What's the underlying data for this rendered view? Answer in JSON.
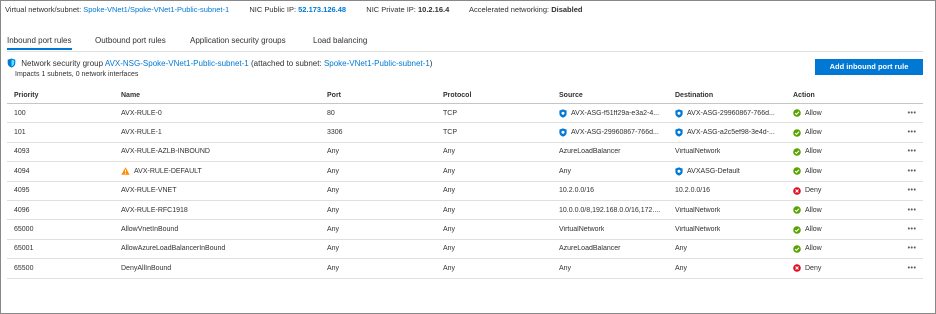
{
  "top_info": {
    "vnet_label": "Virtual network/subnet:",
    "vnet_value": "Spoke-VNet1/Spoke-VNet1-Public-subnet-1",
    "public_ip_label": "NIC Public IP:",
    "public_ip_value": "52.173.126.48",
    "private_ip_label": "NIC Private IP:",
    "private_ip_value": "10.2.16.4",
    "accel_label": "Accelerated networking:",
    "accel_value": "Disabled"
  },
  "tabs": [
    "Inbound port rules",
    "Outbound port rules",
    "Application security groups",
    "Load balancing"
  ],
  "nsg": {
    "prefix": "Network security group",
    "name": "AVX-NSG-Spoke-VNet1-Public-subnet-1",
    "attached_text": "(attached to subnet:",
    "subnet": "Spoke-VNet1-Public-subnet-1",
    "close": ")",
    "impacts": "Impacts 1 subnets, 0 network interfaces"
  },
  "add_button": "Add inbound port rule",
  "columns": {
    "priority": "Priority",
    "name": "Name",
    "port": "Port",
    "protocol": "Protocol",
    "source": "Source",
    "destination": "Destination",
    "action": "Action"
  },
  "rows": [
    {
      "priority": "100",
      "name": "AVX-RULE-0",
      "warn": false,
      "port": "80",
      "protocol": "TCP",
      "source": "AVX-ASG-f51ff29a-e3a2-4...",
      "source_asg": true,
      "destination": "AVX-ASG-29960867-766d...",
      "destination_asg": true,
      "action": "Allow",
      "allow": true
    },
    {
      "priority": "101",
      "name": "AVX-RULE-1",
      "warn": false,
      "port": "3306",
      "protocol": "TCP",
      "source": "AVX-ASG-29960867-766d...",
      "source_asg": true,
      "destination": "AVX-ASG-a2c5ef98-3e4d-...",
      "destination_asg": true,
      "action": "Allow",
      "allow": true
    },
    {
      "priority": "4093",
      "name": "AVX-RULE-AZLB-INBOUND",
      "warn": false,
      "port": "Any",
      "protocol": "Any",
      "source": "AzureLoadBalancer",
      "source_asg": false,
      "destination": "VirtualNetwork",
      "destination_asg": false,
      "action": "Allow",
      "allow": true
    },
    {
      "priority": "4094",
      "name": "AVX-RULE-DEFAULT",
      "warn": true,
      "port": "Any",
      "protocol": "Any",
      "source": "Any",
      "source_asg": false,
      "destination": "AVXASG-Default",
      "destination_asg": true,
      "action": "Allow",
      "allow": true
    },
    {
      "priority": "4095",
      "name": "AVX-RULE-VNET",
      "warn": false,
      "port": "Any",
      "protocol": "Any",
      "source": "10.2.0.0/16",
      "source_asg": false,
      "destination": "10.2.0.0/16",
      "destination_asg": false,
      "action": "Deny",
      "allow": false
    },
    {
      "priority": "4096",
      "name": "AVX-RULE-RFC1918",
      "warn": false,
      "port": "Any",
      "protocol": "Any",
      "source": "10.0.0.0/8,192.168.0.0/16,172....",
      "source_asg": false,
      "destination": "VirtualNetwork",
      "destination_asg": false,
      "action": "Allow",
      "allow": true
    },
    {
      "priority": "65000",
      "name": "AllowVnetInBound",
      "warn": false,
      "port": "Any",
      "protocol": "Any",
      "source": "VirtualNetwork",
      "source_asg": false,
      "destination": "VirtualNetwork",
      "destination_asg": false,
      "action": "Allow",
      "allow": true
    },
    {
      "priority": "65001",
      "name": "AllowAzureLoadBalancerInBound",
      "warn": false,
      "port": "Any",
      "protocol": "Any",
      "source": "AzureLoadBalancer",
      "source_asg": false,
      "destination": "Any",
      "destination_asg": false,
      "action": "Allow",
      "allow": true
    },
    {
      "priority": "65500",
      "name": "DenyAllInBound",
      "warn": false,
      "port": "Any",
      "protocol": "Any",
      "source": "Any",
      "source_asg": false,
      "destination": "Any",
      "destination_asg": false,
      "action": "Deny",
      "allow": false
    }
  ],
  "more_label": "•••",
  "colors": {
    "accent": "#0078d4",
    "allow": "#57a300",
    "deny": "#e00b1c",
    "warning": "#ff8c00"
  },
  "icons": {
    "allow": "check-circle-icon",
    "deny": "x-circle-icon",
    "warning": "warning-icon",
    "asg": "application-security-group-icon",
    "nsg": "shield-icon",
    "more": "more-icon"
  }
}
